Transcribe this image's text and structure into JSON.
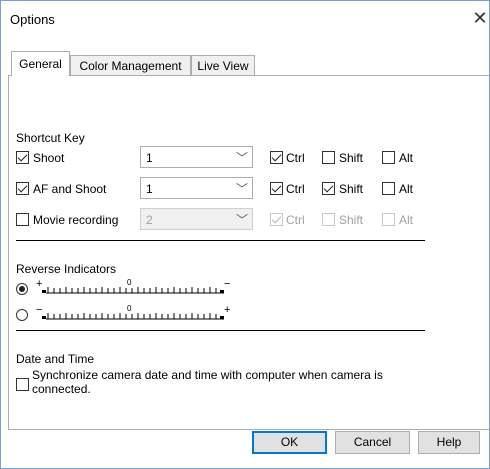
{
  "window": {
    "title": "Options",
    "close_glyph": "✕"
  },
  "tabs": [
    {
      "label": "General",
      "active": true
    },
    {
      "label": "Color Management",
      "active": false
    },
    {
      "label": "Live View",
      "active": false
    }
  ],
  "shortcut": {
    "heading": "Shortcut Key",
    "rows": [
      {
        "label": "Shoot",
        "checked": true,
        "enabled": true,
        "value": "1",
        "ctrl": {
          "label": "Ctrl",
          "checked": true
        },
        "shift": {
          "label": "Shift",
          "checked": false
        },
        "alt": {
          "label": "Alt",
          "checked": false
        }
      },
      {
        "label": "AF and Shoot",
        "checked": true,
        "enabled": true,
        "value": "1",
        "ctrl": {
          "label": "Ctrl",
          "checked": true
        },
        "shift": {
          "label": "Shift",
          "checked": true
        },
        "alt": {
          "label": "Alt",
          "checked": false
        }
      },
      {
        "label": "Movie recording",
        "checked": false,
        "enabled": false,
        "value": "2",
        "ctrl": {
          "label": "Ctrl",
          "checked": true
        },
        "shift": {
          "label": "Shift",
          "checked": false
        },
        "alt": {
          "label": "Alt",
          "checked": false
        }
      }
    ]
  },
  "reverse": {
    "heading": "Reverse Indicators",
    "options": [
      {
        "left_sign": "+",
        "zero": "0",
        "right_sign": "−",
        "selected": true
      },
      {
        "left_sign": "−",
        "zero": "0",
        "right_sign": "+",
        "selected": false
      }
    ]
  },
  "datetime": {
    "heading": "Date and Time",
    "sync_label": "Synchronize camera date and time with computer when camera is connected.",
    "checked": false
  },
  "buttons": {
    "ok": "OK",
    "cancel": "Cancel",
    "help": "Help"
  },
  "colors": {
    "accent": "#0078d7",
    "window_border": "#7a9ed8"
  }
}
